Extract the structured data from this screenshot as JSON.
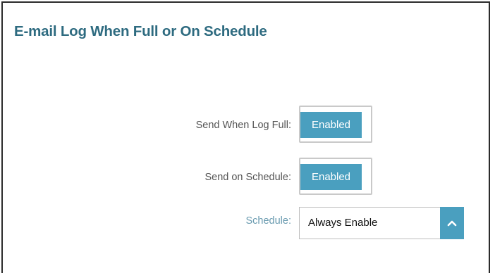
{
  "section": {
    "title": "E-mail Log When Full or On Schedule"
  },
  "rows": {
    "send_when_full": {
      "label": "Send When Log Full:",
      "value": "Enabled"
    },
    "send_on_schedule": {
      "label": "Send on Schedule:",
      "value": "Enabled"
    },
    "schedule": {
      "label": "Schedule:",
      "value": "Always Enable",
      "icon": "chevron-up-icon"
    }
  },
  "colors": {
    "title": "#2e6b80",
    "accent": "#4a9fbf",
    "label": "#555555",
    "schedule_label": "#6a9bb0"
  }
}
